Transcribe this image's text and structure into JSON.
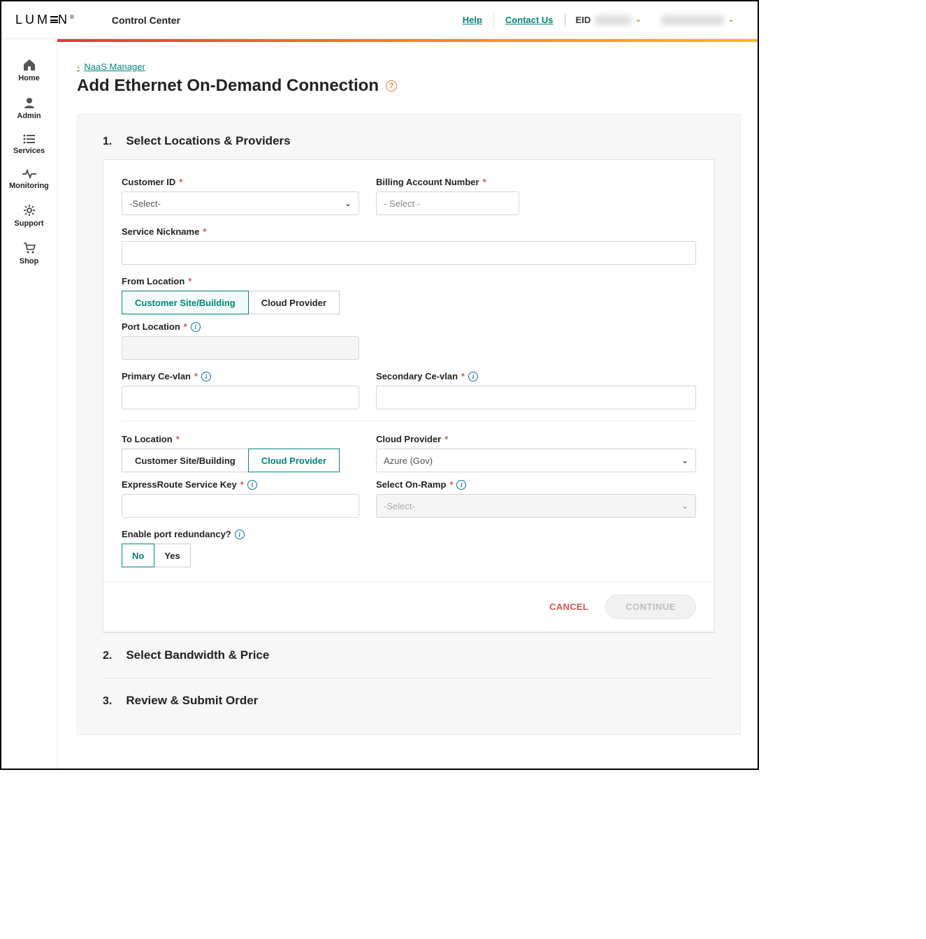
{
  "header": {
    "logo_text": "LUMEN",
    "app_title": "Control Center",
    "help": "Help",
    "contact": "Contact Us",
    "eid_label": "EID"
  },
  "sidebar": {
    "items": [
      {
        "label": "Home"
      },
      {
        "label": "Admin"
      },
      {
        "label": "Services"
      },
      {
        "label": "Monitoring"
      },
      {
        "label": "Support"
      },
      {
        "label": "Shop"
      }
    ]
  },
  "breadcrumb": {
    "parent": "NaaS Manager"
  },
  "page": {
    "title": "Add Ethernet On-Demand Connection"
  },
  "steps": [
    {
      "num": "1.",
      "title": "Select Locations & Providers"
    },
    {
      "num": "2.",
      "title": "Select Bandwidth & Price"
    },
    {
      "num": "3.",
      "title": "Review & Submit Order"
    }
  ],
  "form": {
    "customer_id": {
      "label": "Customer ID",
      "value": "-Select-"
    },
    "billing_account": {
      "label": "Billing Account Number",
      "placeholder": "- Select -"
    },
    "service_nickname": {
      "label": "Service Nickname"
    },
    "from_location": {
      "label": "From Location",
      "options": [
        "Customer Site/Building",
        "Cloud Provider"
      ],
      "selected": "Customer Site/Building"
    },
    "port_location": {
      "label": "Port Location"
    },
    "primary_cevlan": {
      "label": "Primary Ce-vlan"
    },
    "secondary_cevlan": {
      "label": "Secondary Ce-vlan"
    },
    "to_location": {
      "label": "To Location",
      "options": [
        "Customer Site/Building",
        "Cloud Provider"
      ],
      "selected": "Cloud Provider"
    },
    "cloud_provider": {
      "label": "Cloud Provider",
      "value": "Azure (Gov)"
    },
    "expressroute_key": {
      "label": "ExpressRoute Service Key"
    },
    "select_onramp": {
      "label": "Select On-Ramp",
      "placeholder": "-Select-"
    },
    "port_redundancy": {
      "label": "Enable port redundancy?",
      "options": [
        "No",
        "Yes"
      ],
      "selected": "No"
    }
  },
  "actions": {
    "cancel": "CANCEL",
    "continue": "CONTINUE"
  }
}
